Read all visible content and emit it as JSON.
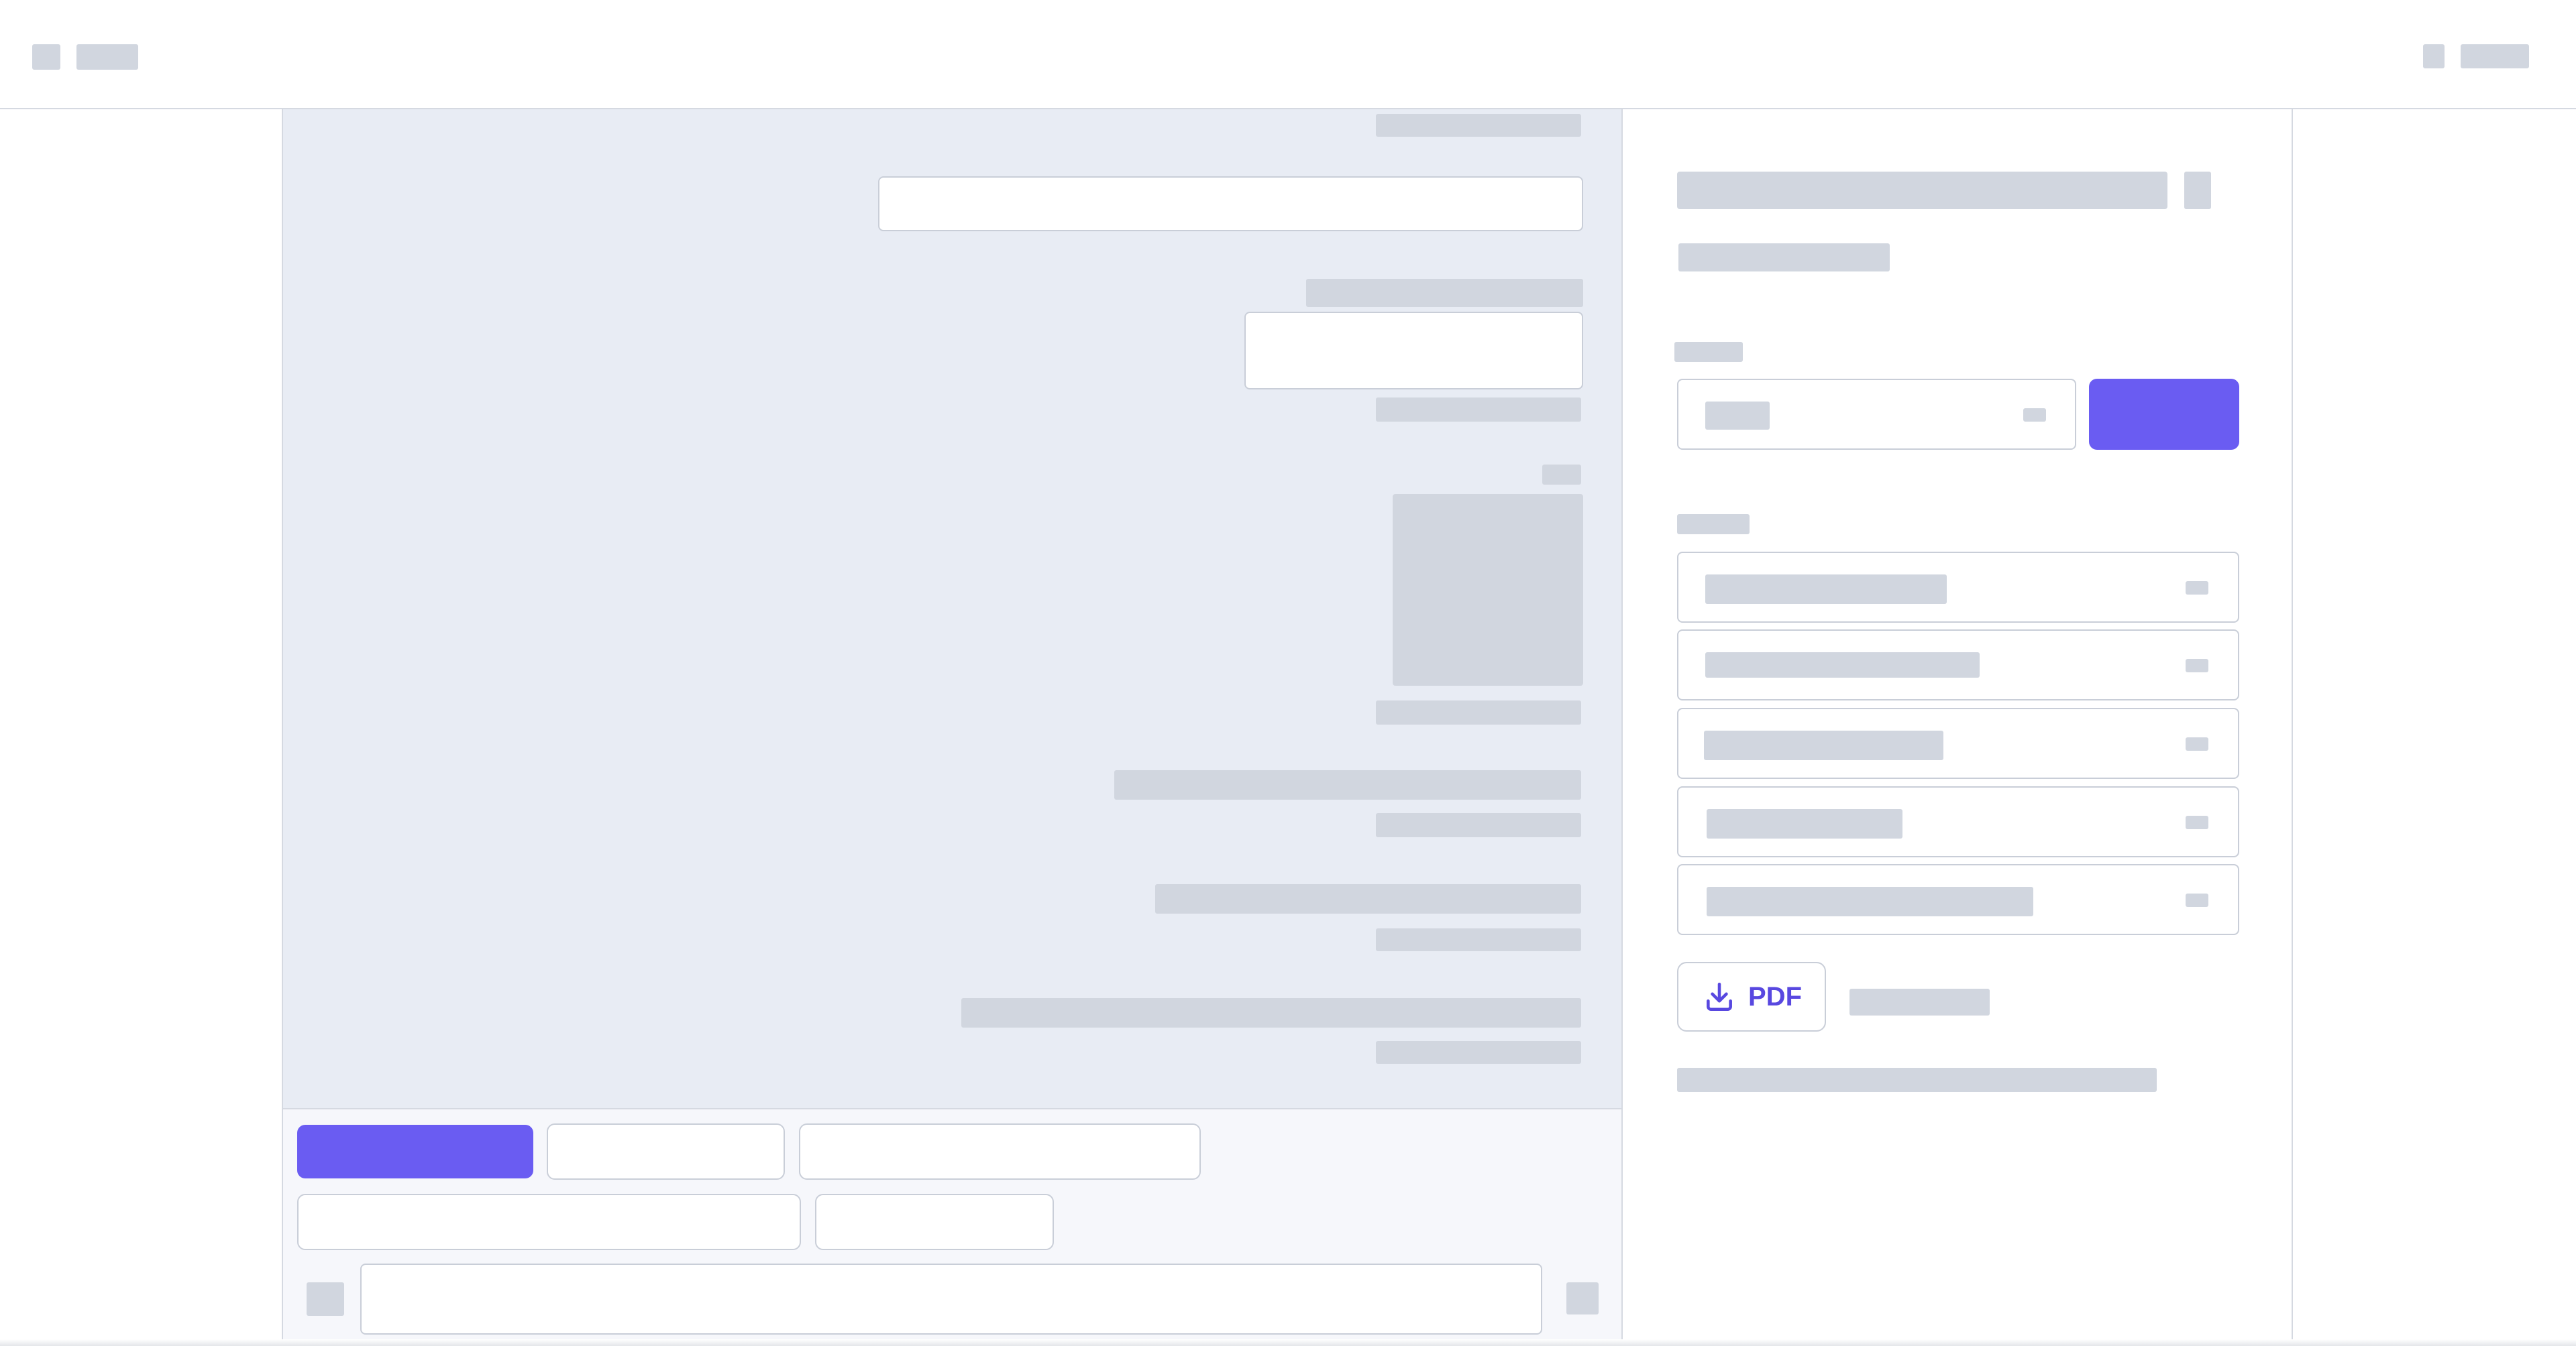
{
  "app": {
    "accent_color": "#6a5cf2",
    "skeleton_color": "#d1d6df",
    "chat_background": "#e8ecf4"
  },
  "export": {
    "pdf_label": "PDF",
    "icon": "download-icon"
  }
}
